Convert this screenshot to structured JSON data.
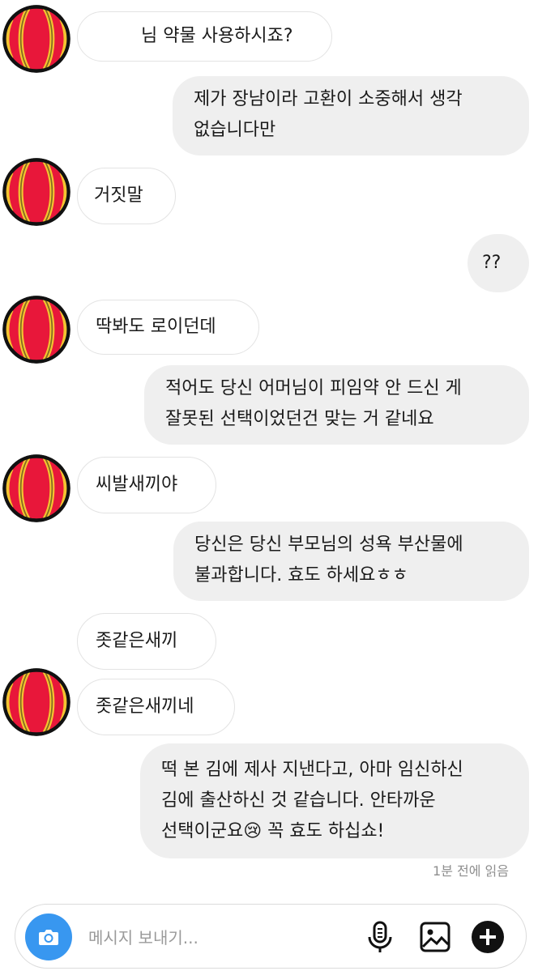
{
  "messages": [
    {
      "dir": "in",
      "text": "님 약물 사용하시죠?"
    },
    {
      "dir": "out",
      "lines": [
        "제가 장남이라 고환이 소중해서 생각",
        "없습니다만"
      ]
    },
    {
      "dir": "in",
      "text": "거짓말"
    },
    {
      "dir": "out",
      "text": "??"
    },
    {
      "dir": "in",
      "text": "딱봐도 로이던데"
    },
    {
      "dir": "out",
      "lines": [
        "적어도 당신 어머님이 피임약 안 드신 게",
        "잘못된 선택이었던건 맞는 거 같네요"
      ]
    },
    {
      "dir": "in",
      "text": "씨발새끼야"
    },
    {
      "dir": "out",
      "lines": [
        "당신은 당신 부모님의 성욕 부산물에",
        "불과합니다. 효도 하세요ㅎㅎ"
      ]
    },
    {
      "dir": "in",
      "text": "좃같은새끼"
    },
    {
      "dir": "in",
      "text": "좃같은새끼네"
    },
    {
      "dir": "out",
      "lines": [
        "떡 본 김에 제사 지낸다고, 아마 임신하신",
        "김에 출산하신 것 같습니다. 안타까운",
        "선택이군요😢 꼭 효도 하십쇼!"
      ]
    }
  ],
  "read_receipt": "1분 전에 읽음",
  "composer": {
    "placeholder": "메시지 보내기...",
    "icons": [
      "camera-icon",
      "microphone-icon",
      "image-icon",
      "plus-icon"
    ]
  },
  "colors": {
    "camera_button": "#3897f0",
    "outgoing_bubble": "#efefef",
    "incoming_border": "#e3e3e3",
    "avatar_red": "#e8173a",
    "avatar_yellow": "#f4c430"
  }
}
